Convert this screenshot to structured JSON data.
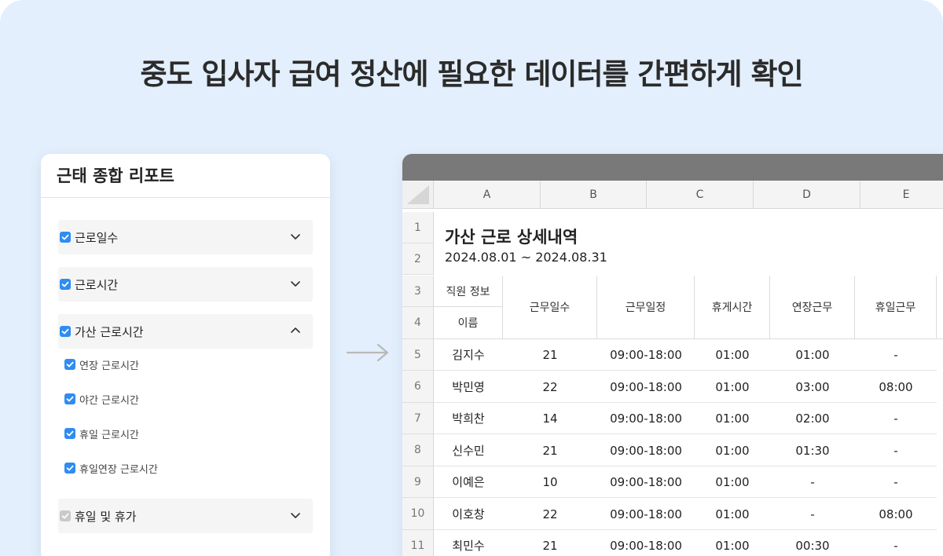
{
  "headline": "중도 입사자 급여 정산에 필요한 데이터를 간편하게 확인",
  "colors": {
    "background": "#e3effc",
    "checkbox": "#2f8cf2",
    "checkbox_disabled": "#c9c9c9",
    "titlebar": "#797979"
  },
  "panel": {
    "title": "근태 종합 리포트",
    "items": [
      {
        "label": "근로일수",
        "checked": true,
        "icon": "chevron-down-icon"
      },
      {
        "label": "근로시간",
        "checked": true,
        "icon": "chevron-down-icon"
      },
      {
        "label": "가산 근로시간",
        "checked": true,
        "icon": "chevron-up-icon"
      },
      {
        "label": "휴일 및 휴가",
        "checked": true,
        "disabled": true,
        "icon": "chevron-down-icon"
      }
    ],
    "subitems": [
      {
        "label": "연장 근로시간",
        "checked": true
      },
      {
        "label": "야간 근로시간",
        "checked": true
      },
      {
        "label": "휴일 근로시간",
        "checked": true
      },
      {
        "label": "휴일연장 근로시간",
        "checked": true
      }
    ]
  },
  "sheet": {
    "columns": [
      "A",
      "B",
      "C",
      "D",
      "E"
    ],
    "row_numbers": [
      "1",
      "2",
      "3",
      "4",
      "5",
      "6",
      "7",
      "8",
      "9",
      "10",
      "11"
    ],
    "title": "가산 근로 상세내역",
    "date_range": "2024.08.01 ~ 2024.08.31",
    "header": {
      "group": "직원 정보",
      "name": "이름",
      "cols": [
        "근무일수",
        "근무일정",
        "휴게시간",
        "연장근무",
        "휴일근무"
      ]
    },
    "rows": [
      [
        "김지수",
        "21",
        "09:00-18:00",
        "01:00",
        "01:00",
        "-"
      ],
      [
        "박민영",
        "22",
        "09:00-18:00",
        "01:00",
        "03:00",
        "08:00"
      ],
      [
        "박희찬",
        "14",
        "09:00-18:00",
        "01:00",
        "02:00",
        "-"
      ],
      [
        "신수민",
        "21",
        "09:00-18:00",
        "01:00",
        "01:30",
        "-"
      ],
      [
        "이예은",
        "10",
        "09:00-18:00",
        "01:00",
        "-",
        "-"
      ],
      [
        "이호창",
        "22",
        "09:00-18:00",
        "01:00",
        "-",
        "08:00"
      ],
      [
        "최민수",
        "21",
        "09:00-18:00",
        "01:00",
        "00:30",
        "-"
      ]
    ]
  }
}
